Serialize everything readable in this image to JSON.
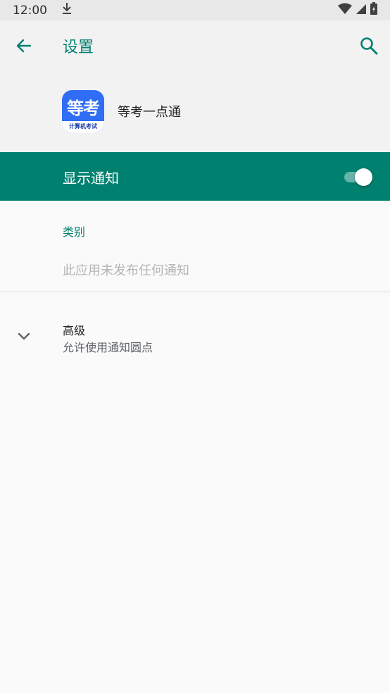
{
  "status_bar": {
    "time": "12:00"
  },
  "app_bar": {
    "title": "设置"
  },
  "app_header": {
    "icon_big_text": "等考",
    "icon_small_text": "计算机考试",
    "app_name": "等考一点通"
  },
  "master_switch": {
    "label": "显示通知",
    "checked": true
  },
  "category": {
    "header": "类别",
    "empty_text": "此应用未发布任何通知"
  },
  "advanced": {
    "title": "高级",
    "summary": "允许使用通知圆点"
  },
  "colors": {
    "accent": "#00806f",
    "background": "#fafafa",
    "header_background": "#f2f2f2"
  }
}
